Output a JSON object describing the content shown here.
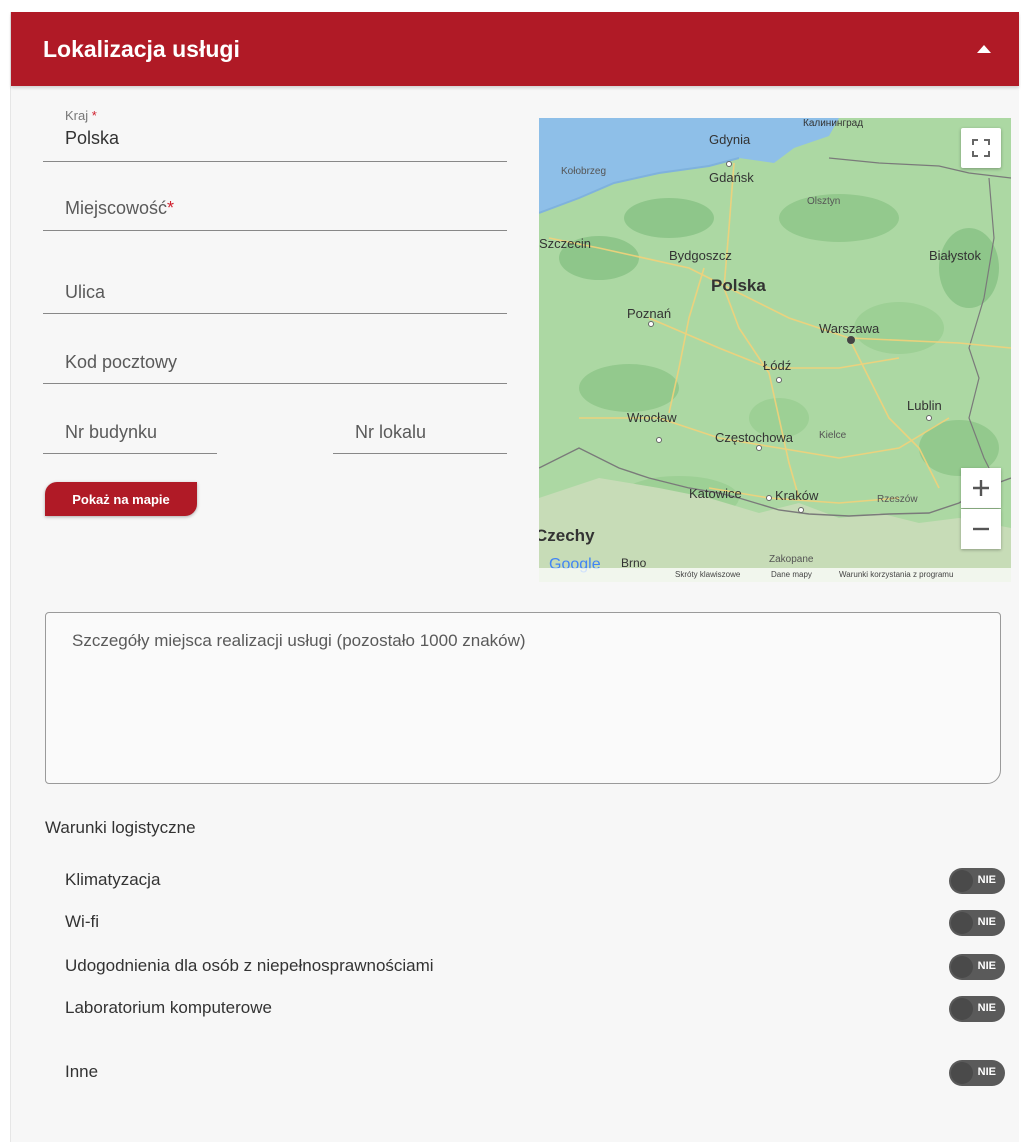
{
  "header": {
    "title": "Lokalizacja usługi"
  },
  "form": {
    "country": {
      "label": "Kraj",
      "required_mark": "*",
      "value": "Polska"
    },
    "city": {
      "placeholder": "Miejscowość",
      "required_mark": "*"
    },
    "street": {
      "placeholder": "Ulica"
    },
    "postal_code": {
      "placeholder": "Kod pocztowy"
    },
    "building_no": {
      "placeholder": "Nr budynku"
    },
    "unit_no": {
      "placeholder": "Nr lokalu"
    },
    "show_on_map_label": "Pokaż na mapie"
  },
  "map": {
    "labels": {
      "kaliningrad": "Калининград",
      "gdynia": "Gdynia",
      "gdansk": "Gdańsk",
      "kolobrzeg": "Kołobrzeg",
      "olsztyn": "Olsztyn",
      "szczecin": "Szczecin",
      "bydgoszcz": "Bydgoszcz",
      "bialystok": "Białystok",
      "polska": "Polska",
      "poznan": "Poznań",
      "warszawa": "Warszawa",
      "lodz": "Łódź",
      "lublin": "Lublin",
      "wroclaw": "Wrocław",
      "czestochowa": "Częstochowa",
      "kielce": "Kielce",
      "katowice": "Katowice",
      "krakow": "Kraków",
      "rzeszow": "Rzeszów",
      "czechy": "Czechy",
      "brno": "Brno",
      "zakopane": "Zakopane"
    },
    "footer": {
      "shortcuts": "Skróty klawiszowe",
      "map_data": "Dane mapy",
      "terms": "Warunki korzystania z programu"
    },
    "google": "Google"
  },
  "details": {
    "placeholder": "Szczegóły miejsca realizacji usługi (pozostało 1000 znaków)"
  },
  "logistics": {
    "title": "Warunki logistyczne",
    "items": [
      {
        "label": "Klimatyzacja",
        "toggle": "NIE"
      },
      {
        "label": "Wi-fi",
        "toggle": "NIE"
      },
      {
        "label": "Udogodnienia dla osób z niepełnosprawnościami",
        "toggle": "NIE"
      },
      {
        "label": "Laboratorium komputerowe",
        "toggle": "NIE"
      },
      {
        "label": "Inne",
        "toggle": "NIE"
      }
    ]
  },
  "colors": {
    "accent": "#b01a26",
    "toggle_off": "#5a5a5a"
  }
}
